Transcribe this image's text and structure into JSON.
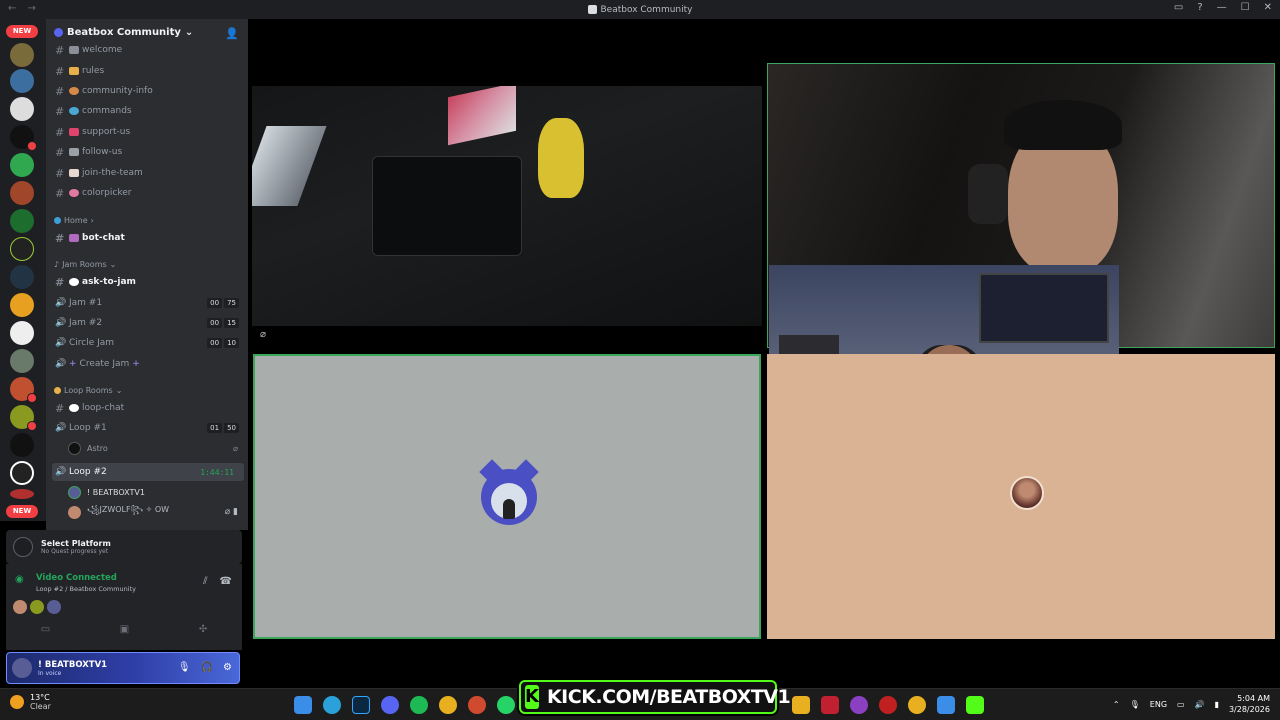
{
  "window": {
    "title": "Beatbox Community",
    "nav": "← →"
  },
  "guild": {
    "name": "Beatbox Community"
  },
  "new_badge": "NEW",
  "channels": [
    {
      "name": "welcome"
    },
    {
      "name": "rules"
    },
    {
      "name": "community-info"
    },
    {
      "name": "commands"
    },
    {
      "name": "support-us"
    },
    {
      "name": "follow-us"
    },
    {
      "name": "join-the-team"
    },
    {
      "name": "colorpicker"
    }
  ],
  "category_home": "Home",
  "bot_chat": "bot-chat",
  "category_jam": "Jam Rooms",
  "ask_to_jam": "ask-to-jam",
  "voice_jam": [
    {
      "name": "Jam #1",
      "c1": "00",
      "c2": "75"
    },
    {
      "name": "Jam #2",
      "c1": "00",
      "c2": "15"
    },
    {
      "name": "Circle Jam",
      "c1": "00",
      "c2": "10"
    }
  ],
  "create_jam": "Create Jam",
  "category_loop": "Loop Rooms",
  "loop_chat": "loop-chat",
  "loop1": {
    "name": "Loop #1",
    "c1": "01",
    "c2": "50"
  },
  "loop1_member": "Astro",
  "loop2": {
    "name": "Loop #2",
    "timer": "1:44:11"
  },
  "loop2_members": [
    "! BEATBOXTV1",
    "꧁JZWOLF꧂ ✧ OW"
  ],
  "quest": {
    "title": "Select Platform",
    "sub": "No Quest progress yet"
  },
  "voice": {
    "status": "Video Connected",
    "sub": "Loop #2 / Beatbox Community"
  },
  "user": {
    "name": "! BEATBOXTV1",
    "status": "In voice"
  },
  "taskbar": {
    "temp": "13°C",
    "cond": "Clear",
    "lang": "ENG",
    "time": "5:04 AM",
    "date": "3/28/2026"
  },
  "kick_url": "KICK.COM/BEATBOXTV1",
  "kick_logo": "K"
}
